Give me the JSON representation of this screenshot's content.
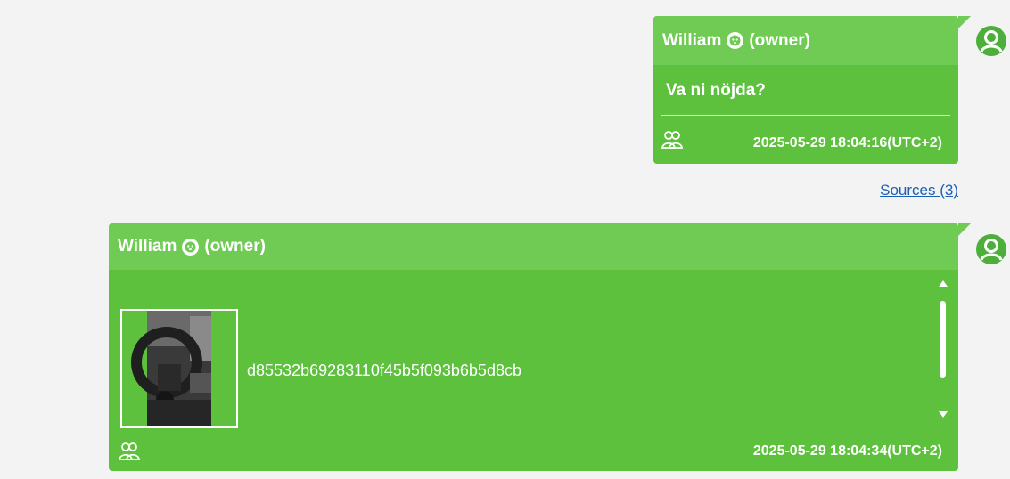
{
  "messages": [
    {
      "sender": "William",
      "role": "(owner)",
      "text": "Va ni nöjda?",
      "timestamp": "2025-05-29 18:04:16(UTC+2)",
      "sources_link": "Sources (3)"
    },
    {
      "sender": "William",
      "role": "(owner)",
      "attachment_name": "d85532b69283110f45b5f093b6b5d8cb",
      "timestamp": "2025-05-29 18:04:34(UTC+2)"
    }
  ],
  "icons": {
    "badge": "dog-face-icon",
    "group": "group-users-icon",
    "avatar": "user-avatar-icon",
    "scroll_up": "caret-up-icon",
    "scroll_down": "caret-down-icon"
  },
  "colors": {
    "bubble": "#5ec13e",
    "bubble_header": "#6fcb53",
    "avatar": "#4caf3a",
    "link": "#1a5fb4",
    "background": "#f3f3f3"
  }
}
